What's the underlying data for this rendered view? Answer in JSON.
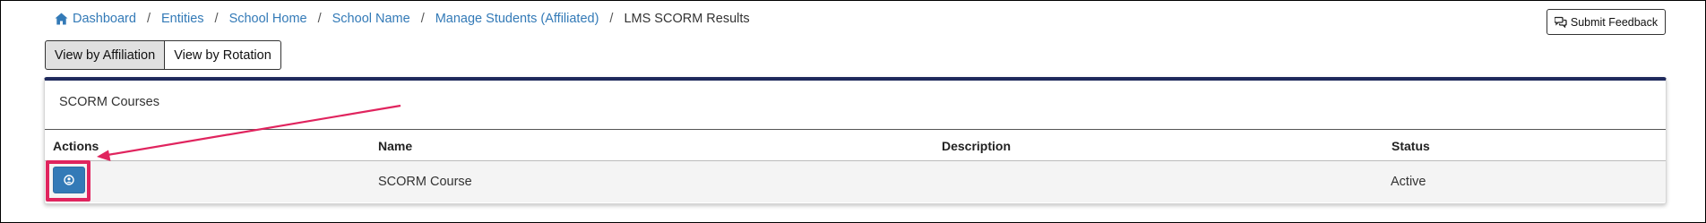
{
  "breadcrumb": {
    "items": [
      "Dashboard",
      "Entities",
      "School Home",
      "School Name",
      "Manage Students (Affiliated)"
    ],
    "current": "LMS SCORM Results",
    "separator": "/"
  },
  "header": {
    "feedback_label": "Submit Feedback"
  },
  "view_toggle": {
    "affiliation": "View by Affiliation",
    "rotation": "View by Rotation"
  },
  "panel": {
    "title": "SCORM Courses",
    "columns": {
      "actions": "Actions",
      "name": "Name",
      "description": "Description",
      "status": "Status"
    },
    "rows": [
      {
        "name": "SCORM Course",
        "description": "",
        "status": "Active"
      }
    ]
  },
  "colors": {
    "link": "#337ab7",
    "panel_accent": "#1f2a5c",
    "annotation": "#e0245e",
    "action_button": "#337ab7"
  }
}
